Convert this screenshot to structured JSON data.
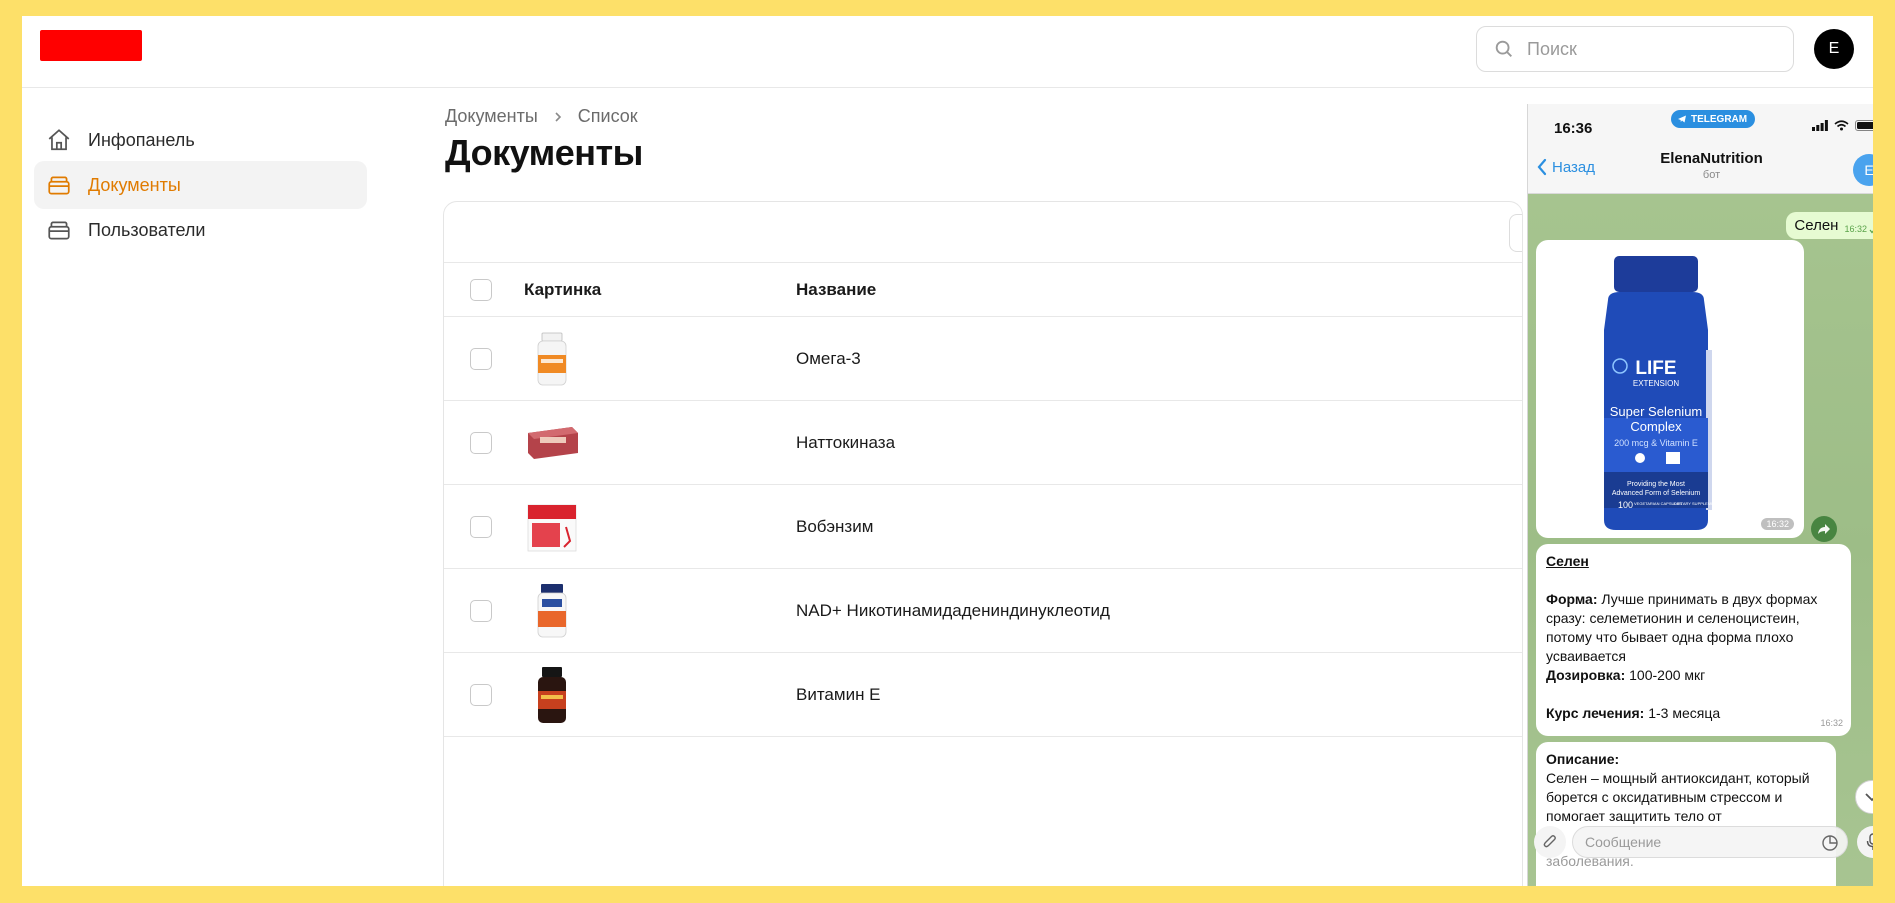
{
  "header": {
    "search_placeholder": "Поиск",
    "avatar_letter": "E"
  },
  "sidebar": {
    "items": [
      {
        "label": "Инфопанель",
        "icon": "home-icon",
        "active": false
      },
      {
        "label": "Документы",
        "icon": "folder-icon",
        "active": true
      },
      {
        "label": "Пользователи",
        "icon": "folder-icon",
        "active": false
      }
    ]
  },
  "breadcrumb": [
    "Документы",
    "Список"
  ],
  "page_title": "Документы",
  "table": {
    "columns": [
      "Картинка",
      "Название"
    ],
    "rows": [
      {
        "name": "Омега-3",
        "thumb": "omega-bottle"
      },
      {
        "name": "Наттокиназа",
        "thumb": "nattokinase-box"
      },
      {
        "name": "Вобэнзим",
        "thumb": "wobenzym-box"
      },
      {
        "name": "NAD+ Никотинамидадениндинуклеотид",
        "thumb": "nad-bottle"
      },
      {
        "name": "Витамин E",
        "thumb": "vitamin-e-bottle"
      }
    ]
  },
  "phone": {
    "time": "16:36",
    "badge": "TELEGRAM",
    "back_label": "Назад",
    "chat_title": "ElenaNutrition",
    "chat_subtitle": "бот",
    "chat_avatar": "E",
    "outgoing": {
      "text": "Селен",
      "time": "16:32"
    },
    "photo": {
      "time": "16:32",
      "label_brand": "LIFE",
      "label_brand_sub": "EXTENSION",
      "label_product": "Super Selenium",
      "label_product2": "Complex",
      "label_dose": "200 mcg & Vitamin E",
      "label_tag1": "Providing the Most",
      "label_tag2": "Advanced Form of Selenium",
      "label_count": "100",
      "label_caps": "VEGETARIAN CAPSULES",
      "label_dietary": "DIETARY SUPPLEMENT"
    },
    "message1": {
      "title": "Селен",
      "form_label": "Форма:",
      "form_text": " Лучше принимать в двух формах сразу: селеметионин и селеноцистеин, потому что бывает одна форма плохо усваивается",
      "dose_label": "Дозировка:",
      "dose_text": " 100-200 мкг",
      "course_label": "Курс лечения:",
      "course_text": " 1-3 месяца",
      "time": "16:32"
    },
    "message2": {
      "title": "Описание:",
      "text": "Селен – мощный антиоксидант, который борется с оксидативным стрессом и помогает защитить тело от",
      "text_hidden": "заболевания."
    },
    "input_placeholder": "Сообщение"
  },
  "colors": {
    "frame": "#fde069",
    "accent": "#e07b00",
    "telegram": "#2b8fe0",
    "logo": "#ff0000"
  }
}
